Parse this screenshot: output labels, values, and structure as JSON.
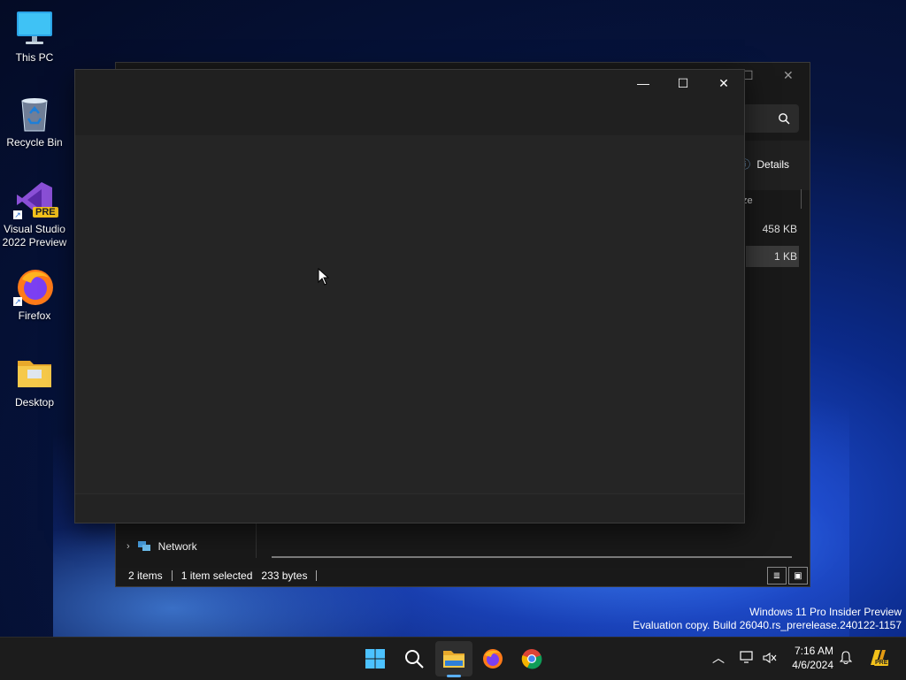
{
  "desktop": {
    "icons": [
      {
        "label": "This PC"
      },
      {
        "label": "Recycle Bin"
      },
      {
        "label": "Visual Studio 2022 Preview",
        "label_line1": "Visual Studio",
        "label_line2": "2022 Preview",
        "badge": "PRE"
      },
      {
        "label": "Firefox"
      },
      {
        "label": "Desktop"
      }
    ]
  },
  "explorer": {
    "details_label": "Details",
    "column_header": "ze",
    "rows": [
      {
        "size": "458 KB"
      },
      {
        "size": "1 KB"
      }
    ],
    "nav_item": "Network",
    "status": {
      "items": "2 items",
      "selected": "1 item selected",
      "size": "233 bytes"
    }
  },
  "blank_window": {
    "controls": {
      "minimize": "—",
      "maximize": "☐",
      "close": "✕"
    }
  },
  "watermark": {
    "line1": "Windows 11 Pro Insider Preview",
    "line2": "Evaluation copy. Build 26040.rs_prerelease.240122-1157"
  },
  "taskbar": {
    "time": "7:16 AM",
    "date": "4/6/2024",
    "copilot_badge": "PRE"
  },
  "colors": {
    "accent": "#5ab0ff",
    "window_bg": "#252525",
    "titlebar_bg": "#202020"
  }
}
